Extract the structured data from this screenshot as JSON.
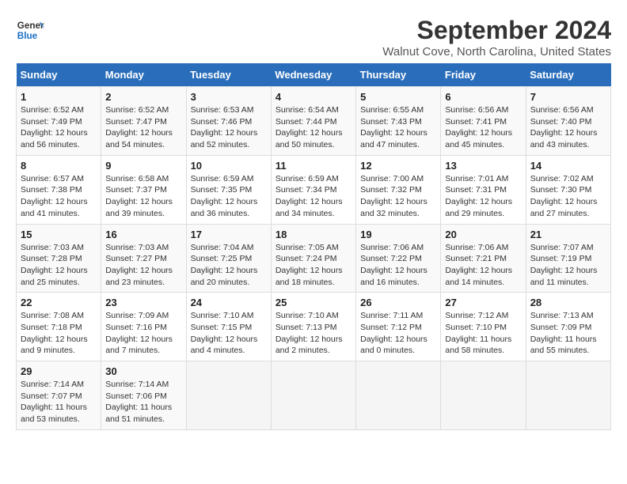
{
  "header": {
    "logo_line1": "General",
    "logo_line2": "Blue",
    "title": "September 2024",
    "subtitle": "Walnut Cove, North Carolina, United States"
  },
  "columns": [
    "Sunday",
    "Monday",
    "Tuesday",
    "Wednesday",
    "Thursday",
    "Friday",
    "Saturday"
  ],
  "weeks": [
    [
      {
        "day": "1",
        "info": "Sunrise: 6:52 AM\nSunset: 7:49 PM\nDaylight: 12 hours\nand 56 minutes."
      },
      {
        "day": "2",
        "info": "Sunrise: 6:52 AM\nSunset: 7:47 PM\nDaylight: 12 hours\nand 54 minutes."
      },
      {
        "day": "3",
        "info": "Sunrise: 6:53 AM\nSunset: 7:46 PM\nDaylight: 12 hours\nand 52 minutes."
      },
      {
        "day": "4",
        "info": "Sunrise: 6:54 AM\nSunset: 7:44 PM\nDaylight: 12 hours\nand 50 minutes."
      },
      {
        "day": "5",
        "info": "Sunrise: 6:55 AM\nSunset: 7:43 PM\nDaylight: 12 hours\nand 47 minutes."
      },
      {
        "day": "6",
        "info": "Sunrise: 6:56 AM\nSunset: 7:41 PM\nDaylight: 12 hours\nand 45 minutes."
      },
      {
        "day": "7",
        "info": "Sunrise: 6:56 AM\nSunset: 7:40 PM\nDaylight: 12 hours\nand 43 minutes."
      }
    ],
    [
      {
        "day": "8",
        "info": "Sunrise: 6:57 AM\nSunset: 7:38 PM\nDaylight: 12 hours\nand 41 minutes."
      },
      {
        "day": "9",
        "info": "Sunrise: 6:58 AM\nSunset: 7:37 PM\nDaylight: 12 hours\nand 39 minutes."
      },
      {
        "day": "10",
        "info": "Sunrise: 6:59 AM\nSunset: 7:35 PM\nDaylight: 12 hours\nand 36 minutes."
      },
      {
        "day": "11",
        "info": "Sunrise: 6:59 AM\nSunset: 7:34 PM\nDaylight: 12 hours\nand 34 minutes."
      },
      {
        "day": "12",
        "info": "Sunrise: 7:00 AM\nSunset: 7:32 PM\nDaylight: 12 hours\nand 32 minutes."
      },
      {
        "day": "13",
        "info": "Sunrise: 7:01 AM\nSunset: 7:31 PM\nDaylight: 12 hours\nand 29 minutes."
      },
      {
        "day": "14",
        "info": "Sunrise: 7:02 AM\nSunset: 7:30 PM\nDaylight: 12 hours\nand 27 minutes."
      }
    ],
    [
      {
        "day": "15",
        "info": "Sunrise: 7:03 AM\nSunset: 7:28 PM\nDaylight: 12 hours\nand 25 minutes."
      },
      {
        "day": "16",
        "info": "Sunrise: 7:03 AM\nSunset: 7:27 PM\nDaylight: 12 hours\nand 23 minutes."
      },
      {
        "day": "17",
        "info": "Sunrise: 7:04 AM\nSunset: 7:25 PM\nDaylight: 12 hours\nand 20 minutes."
      },
      {
        "day": "18",
        "info": "Sunrise: 7:05 AM\nSunset: 7:24 PM\nDaylight: 12 hours\nand 18 minutes."
      },
      {
        "day": "19",
        "info": "Sunrise: 7:06 AM\nSunset: 7:22 PM\nDaylight: 12 hours\nand 16 minutes."
      },
      {
        "day": "20",
        "info": "Sunrise: 7:06 AM\nSunset: 7:21 PM\nDaylight: 12 hours\nand 14 minutes."
      },
      {
        "day": "21",
        "info": "Sunrise: 7:07 AM\nSunset: 7:19 PM\nDaylight: 12 hours\nand 11 minutes."
      }
    ],
    [
      {
        "day": "22",
        "info": "Sunrise: 7:08 AM\nSunset: 7:18 PM\nDaylight: 12 hours\nand 9 minutes."
      },
      {
        "day": "23",
        "info": "Sunrise: 7:09 AM\nSunset: 7:16 PM\nDaylight: 12 hours\nand 7 minutes."
      },
      {
        "day": "24",
        "info": "Sunrise: 7:10 AM\nSunset: 7:15 PM\nDaylight: 12 hours\nand 4 minutes."
      },
      {
        "day": "25",
        "info": "Sunrise: 7:10 AM\nSunset: 7:13 PM\nDaylight: 12 hours\nand 2 minutes."
      },
      {
        "day": "26",
        "info": "Sunrise: 7:11 AM\nSunset: 7:12 PM\nDaylight: 12 hours\nand 0 minutes."
      },
      {
        "day": "27",
        "info": "Sunrise: 7:12 AM\nSunset: 7:10 PM\nDaylight: 11 hours\nand 58 minutes."
      },
      {
        "day": "28",
        "info": "Sunrise: 7:13 AM\nSunset: 7:09 PM\nDaylight: 11 hours\nand 55 minutes."
      }
    ],
    [
      {
        "day": "29",
        "info": "Sunrise: 7:14 AM\nSunset: 7:07 PM\nDaylight: 11 hours\nand 53 minutes."
      },
      {
        "day": "30",
        "info": "Sunrise: 7:14 AM\nSunset: 7:06 PM\nDaylight: 11 hours\nand 51 minutes."
      },
      {
        "day": "",
        "info": ""
      },
      {
        "day": "",
        "info": ""
      },
      {
        "day": "",
        "info": ""
      },
      {
        "day": "",
        "info": ""
      },
      {
        "day": "",
        "info": ""
      }
    ]
  ]
}
